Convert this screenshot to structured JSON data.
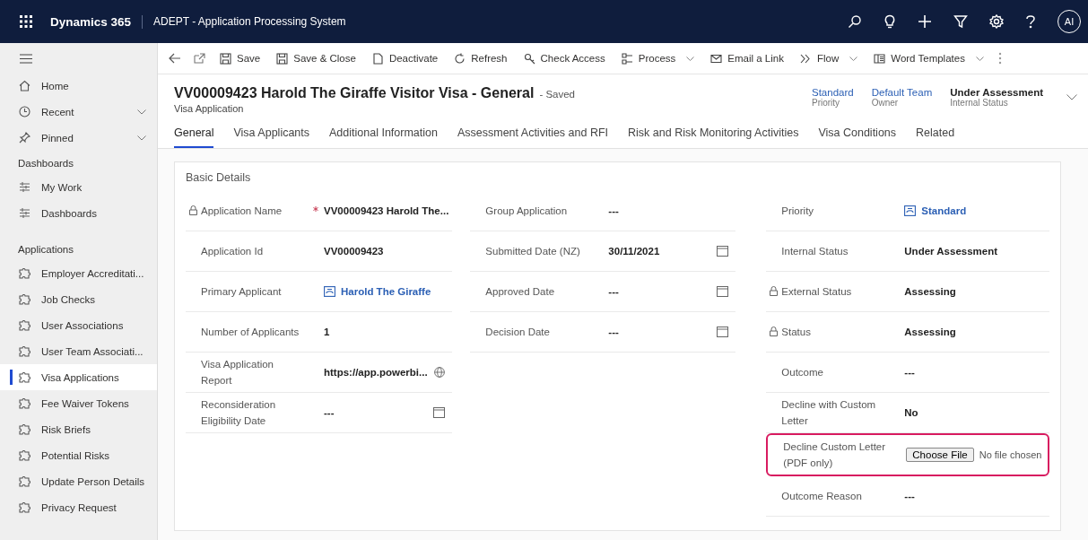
{
  "topbar": {
    "app_name": "Dynamics 365",
    "area_name": "ADEPT - Application Processing System",
    "user_initials": "AI"
  },
  "commands": [
    {
      "label": "Save",
      "has_menu": false
    },
    {
      "label": "Save & Close",
      "has_menu": false
    },
    {
      "label": "Deactivate",
      "has_menu": false
    },
    {
      "label": "Refresh",
      "has_menu": false
    },
    {
      "label": "Check Access",
      "has_menu": false
    },
    {
      "label": "Process",
      "has_menu": true
    },
    {
      "label": "Email a Link",
      "has_menu": false
    },
    {
      "label": "Flow",
      "has_menu": true
    },
    {
      "label": "Word Templates",
      "has_menu": true
    }
  ],
  "sidebar": {
    "top_items": [
      {
        "label": "Home",
        "has_menu": false
      },
      {
        "label": "Recent",
        "has_menu": true
      },
      {
        "label": "Pinned",
        "has_menu": true
      }
    ],
    "groups": [
      {
        "title": "Dashboards",
        "items": [
          {
            "label": "My Work",
            "selected": false
          },
          {
            "label": "Dashboards",
            "selected": false
          }
        ]
      },
      {
        "title": "Applications",
        "items": [
          {
            "label": "Employer Accreditati...",
            "selected": false
          },
          {
            "label": "Job Checks",
            "selected": false
          },
          {
            "label": "User Associations",
            "selected": false
          },
          {
            "label": "User Team Associati...",
            "selected": false
          },
          {
            "label": "Visa Applications",
            "selected": true
          },
          {
            "label": "Fee Waiver Tokens",
            "selected": false
          },
          {
            "label": "Risk Briefs",
            "selected": false
          },
          {
            "label": "Potential Risks",
            "selected": false
          },
          {
            "label": "Update Person Details",
            "selected": false
          },
          {
            "label": "Privacy Request",
            "selected": false
          }
        ]
      }
    ]
  },
  "header": {
    "title": "VV00009423 Harold The Giraffe Visitor Visa - General",
    "save_status": "- Saved",
    "entity": "Visa Application",
    "fields": [
      {
        "value": "Standard",
        "label": "Priority",
        "link": true
      },
      {
        "value": "Default Team",
        "label": "Owner",
        "link": true
      },
      {
        "value": "Under Assessment",
        "label": "Internal Status",
        "link": false
      }
    ]
  },
  "tabs": [
    {
      "label": "General",
      "selected": true
    },
    {
      "label": "Visa Applicants",
      "selected": false
    },
    {
      "label": "Additional Information",
      "selected": false
    },
    {
      "label": "Assessment Activities and RFI",
      "selected": false
    },
    {
      "label": "Risk and Risk Monitoring Activities",
      "selected": false
    },
    {
      "label": "Visa Conditions",
      "selected": false
    },
    {
      "label": "Related",
      "selected": false
    }
  ],
  "section": {
    "title": "Basic Details",
    "columns": [
      {
        "fields": [
          {
            "label": "Application Name",
            "value": "VV00009423 Harold The...",
            "kind": "text",
            "locked": true,
            "required": true,
            "highlighted": false
          },
          {
            "label": "Application Id",
            "value": "VV00009423",
            "kind": "text",
            "locked": false,
            "required": false,
            "highlighted": false
          },
          {
            "label": "Primary Applicant",
            "value": "Harold The Giraffe",
            "kind": "lookup",
            "locked": false,
            "required": false,
            "highlighted": false
          },
          {
            "label": "Number of Applicants",
            "value": "1",
            "kind": "text",
            "locked": false,
            "required": false,
            "highlighted": false
          },
          {
            "label": "Visa Application Report",
            "value": "https://app.powerbi...",
            "kind": "url",
            "locked": false,
            "required": false,
            "highlighted": false
          },
          {
            "label": "Reconsideration Eligibility Date",
            "value": "---",
            "kind": "date",
            "locked": false,
            "required": false,
            "highlighted": false
          }
        ]
      },
      {
        "fields": [
          {
            "label": "Group Application",
            "value": "---",
            "kind": "text",
            "locked": false,
            "required": false,
            "highlighted": false
          },
          {
            "label": "Submitted Date (NZ)",
            "value": "30/11/2021",
            "kind": "date",
            "locked": false,
            "required": false,
            "highlighted": false
          },
          {
            "label": "Approved Date",
            "value": "---",
            "kind": "date",
            "locked": false,
            "required": false,
            "highlighted": false
          },
          {
            "label": "Decision Date",
            "value": "---",
            "kind": "date",
            "locked": false,
            "required": false,
            "highlighted": false
          }
        ]
      },
      {
        "fields": [
          {
            "label": "Priority",
            "value": "Standard",
            "kind": "lookup",
            "locked": false,
            "required": false,
            "highlighted": false
          },
          {
            "label": "Internal Status",
            "value": "Under Assessment",
            "kind": "text",
            "locked": false,
            "required": false,
            "highlighted": false
          },
          {
            "label": "External Status",
            "value": "Assessing",
            "kind": "text",
            "locked": true,
            "required": false,
            "highlighted": false
          },
          {
            "label": "Status",
            "value": "Assessing",
            "kind": "text",
            "locked": true,
            "required": false,
            "highlighted": false
          },
          {
            "label": "Outcome",
            "value": "---",
            "kind": "text",
            "locked": false,
            "required": false,
            "highlighted": false
          },
          {
            "label": "Decline with Custom Letter",
            "value": "No",
            "kind": "text",
            "locked": false,
            "required": false,
            "highlighted": false
          },
          {
            "label": "Decline Custom Letter (PDF only)",
            "value": "No file chosen",
            "button": "Choose File",
            "kind": "file",
            "locked": false,
            "required": false,
            "highlighted": true
          },
          {
            "label": "Outcome Reason",
            "value": "---",
            "kind": "text",
            "locked": false,
            "required": false,
            "highlighted": false
          }
        ]
      }
    ]
  }
}
